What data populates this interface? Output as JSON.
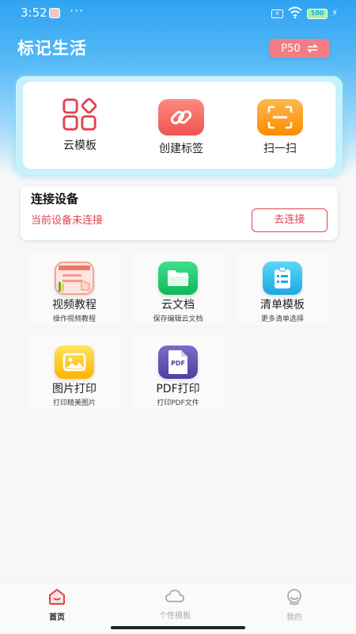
{
  "status_bar": {
    "time": "3:52",
    "dots": "···",
    "battery": "100"
  },
  "app_title": "标记生活",
  "device_chip": {
    "label": "P50",
    "icon": "swap-icon"
  },
  "quick_actions": [
    {
      "label": "云模板",
      "icon": "cloud-template-icon"
    },
    {
      "label": "创建标签",
      "icon": "link-icon"
    },
    {
      "label": "扫一扫",
      "icon": "scan-icon"
    }
  ],
  "connect": {
    "title": "连接设备",
    "status": "当前设备未连接",
    "button": "去连接"
  },
  "grid": [
    {
      "title": "视频教程",
      "subtitle": "操作视频教程",
      "icon": "video-tutorial-icon"
    },
    {
      "title": "云文档",
      "subtitle": "保存编辑云文档",
      "icon": "folder-icon"
    },
    {
      "title": "清单模板",
      "subtitle": "更多清单选择",
      "icon": "checklist-icon"
    },
    {
      "title": "图片打印",
      "subtitle": "打印精美图片",
      "icon": "image-icon"
    },
    {
      "title": "PDF打印",
      "subtitle": "打印PDF文件",
      "icon": "pdf-icon",
      "icon_text": "PDF"
    }
  ],
  "bottom_nav": [
    {
      "label": "首页",
      "icon": "home-icon",
      "active": true
    },
    {
      "label": "个性模板",
      "icon": "cloud-icon",
      "active": false
    },
    {
      "label": "我的",
      "icon": "profile-icon",
      "active": false
    }
  ],
  "colors": {
    "primary_red": "#e0434c",
    "header_blue": "#2fa3f2",
    "chip_pink": "#f27d82"
  }
}
